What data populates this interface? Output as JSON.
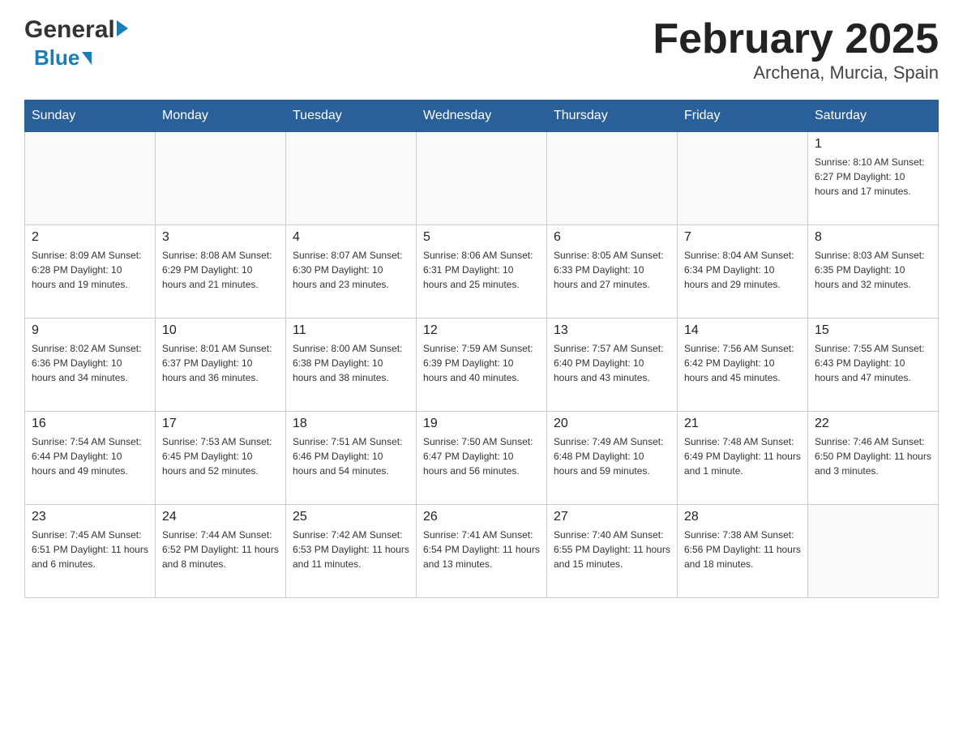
{
  "header": {
    "logo_general": "General",
    "logo_blue": "Blue",
    "title": "February 2025",
    "subtitle": "Archena, Murcia, Spain"
  },
  "calendar": {
    "days_of_week": [
      "Sunday",
      "Monday",
      "Tuesday",
      "Wednesday",
      "Thursday",
      "Friday",
      "Saturday"
    ],
    "weeks": [
      {
        "days": [
          {
            "number": "",
            "info": ""
          },
          {
            "number": "",
            "info": ""
          },
          {
            "number": "",
            "info": ""
          },
          {
            "number": "",
            "info": ""
          },
          {
            "number": "",
            "info": ""
          },
          {
            "number": "",
            "info": ""
          },
          {
            "number": "1",
            "info": "Sunrise: 8:10 AM\nSunset: 6:27 PM\nDaylight: 10 hours\nand 17 minutes."
          }
        ]
      },
      {
        "days": [
          {
            "number": "2",
            "info": "Sunrise: 8:09 AM\nSunset: 6:28 PM\nDaylight: 10 hours\nand 19 minutes."
          },
          {
            "number": "3",
            "info": "Sunrise: 8:08 AM\nSunset: 6:29 PM\nDaylight: 10 hours\nand 21 minutes."
          },
          {
            "number": "4",
            "info": "Sunrise: 8:07 AM\nSunset: 6:30 PM\nDaylight: 10 hours\nand 23 minutes."
          },
          {
            "number": "5",
            "info": "Sunrise: 8:06 AM\nSunset: 6:31 PM\nDaylight: 10 hours\nand 25 minutes."
          },
          {
            "number": "6",
            "info": "Sunrise: 8:05 AM\nSunset: 6:33 PM\nDaylight: 10 hours\nand 27 minutes."
          },
          {
            "number": "7",
            "info": "Sunrise: 8:04 AM\nSunset: 6:34 PM\nDaylight: 10 hours\nand 29 minutes."
          },
          {
            "number": "8",
            "info": "Sunrise: 8:03 AM\nSunset: 6:35 PM\nDaylight: 10 hours\nand 32 minutes."
          }
        ]
      },
      {
        "days": [
          {
            "number": "9",
            "info": "Sunrise: 8:02 AM\nSunset: 6:36 PM\nDaylight: 10 hours\nand 34 minutes."
          },
          {
            "number": "10",
            "info": "Sunrise: 8:01 AM\nSunset: 6:37 PM\nDaylight: 10 hours\nand 36 minutes."
          },
          {
            "number": "11",
            "info": "Sunrise: 8:00 AM\nSunset: 6:38 PM\nDaylight: 10 hours\nand 38 minutes."
          },
          {
            "number": "12",
            "info": "Sunrise: 7:59 AM\nSunset: 6:39 PM\nDaylight: 10 hours\nand 40 minutes."
          },
          {
            "number": "13",
            "info": "Sunrise: 7:57 AM\nSunset: 6:40 PM\nDaylight: 10 hours\nand 43 minutes."
          },
          {
            "number": "14",
            "info": "Sunrise: 7:56 AM\nSunset: 6:42 PM\nDaylight: 10 hours\nand 45 minutes."
          },
          {
            "number": "15",
            "info": "Sunrise: 7:55 AM\nSunset: 6:43 PM\nDaylight: 10 hours\nand 47 minutes."
          }
        ]
      },
      {
        "days": [
          {
            "number": "16",
            "info": "Sunrise: 7:54 AM\nSunset: 6:44 PM\nDaylight: 10 hours\nand 49 minutes."
          },
          {
            "number": "17",
            "info": "Sunrise: 7:53 AM\nSunset: 6:45 PM\nDaylight: 10 hours\nand 52 minutes."
          },
          {
            "number": "18",
            "info": "Sunrise: 7:51 AM\nSunset: 6:46 PM\nDaylight: 10 hours\nand 54 minutes."
          },
          {
            "number": "19",
            "info": "Sunrise: 7:50 AM\nSunset: 6:47 PM\nDaylight: 10 hours\nand 56 minutes."
          },
          {
            "number": "20",
            "info": "Sunrise: 7:49 AM\nSunset: 6:48 PM\nDaylight: 10 hours\nand 59 minutes."
          },
          {
            "number": "21",
            "info": "Sunrise: 7:48 AM\nSunset: 6:49 PM\nDaylight: 11 hours\nand 1 minute."
          },
          {
            "number": "22",
            "info": "Sunrise: 7:46 AM\nSunset: 6:50 PM\nDaylight: 11 hours\nand 3 minutes."
          }
        ]
      },
      {
        "days": [
          {
            "number": "23",
            "info": "Sunrise: 7:45 AM\nSunset: 6:51 PM\nDaylight: 11 hours\nand 6 minutes."
          },
          {
            "number": "24",
            "info": "Sunrise: 7:44 AM\nSunset: 6:52 PM\nDaylight: 11 hours\nand 8 minutes."
          },
          {
            "number": "25",
            "info": "Sunrise: 7:42 AM\nSunset: 6:53 PM\nDaylight: 11 hours\nand 11 minutes."
          },
          {
            "number": "26",
            "info": "Sunrise: 7:41 AM\nSunset: 6:54 PM\nDaylight: 11 hours\nand 13 minutes."
          },
          {
            "number": "27",
            "info": "Sunrise: 7:40 AM\nSunset: 6:55 PM\nDaylight: 11 hours\nand 15 minutes."
          },
          {
            "number": "28",
            "info": "Sunrise: 7:38 AM\nSunset: 6:56 PM\nDaylight: 11 hours\nand 18 minutes."
          },
          {
            "number": "",
            "info": ""
          }
        ]
      }
    ]
  }
}
